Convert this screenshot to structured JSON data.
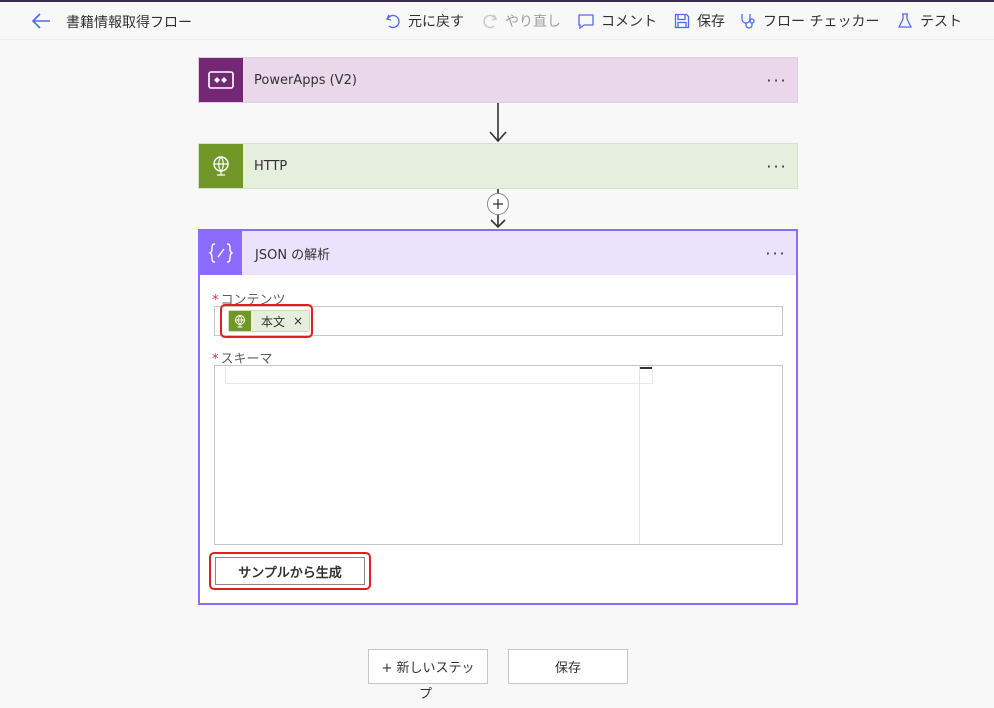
{
  "header": {
    "flow_title": "書籍情報取得フロー",
    "undo_label": "元に戻す",
    "redo_label": "やり直し",
    "comment_label": "コメント",
    "save_label": "保存",
    "checker_label": "フロー チェッカー",
    "test_label": "テスト"
  },
  "steps": {
    "powerapps": {
      "title": "PowerApps (V2)",
      "more": "···",
      "icon": "powerapps-icon",
      "color": "#742774"
    },
    "http": {
      "title": "HTTP",
      "more": "···",
      "icon": "globe-icon",
      "color": "#709727"
    },
    "parse_json": {
      "title": "JSON の解析",
      "more": "···",
      "icon": "braces-icon",
      "color": "#8c6cff",
      "content_label": "コンテンツ",
      "content_token": "本文",
      "token_close": "×",
      "schema_label": "スキーマ",
      "generate_button": "サンプルから生成"
    }
  },
  "footer": {
    "new_step": "+ 新しいステッ",
    "new_step_wrap": "プ",
    "save": "保存"
  }
}
